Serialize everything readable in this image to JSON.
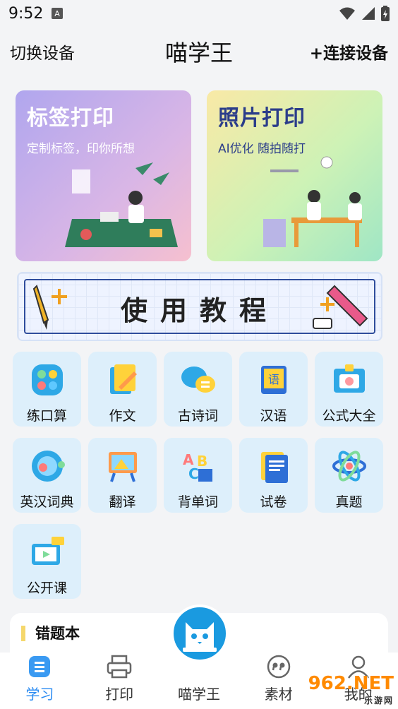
{
  "status": {
    "time": "9:52"
  },
  "header": {
    "left": "切换设备",
    "title": "喵学王",
    "right": "+连接设备"
  },
  "cards": [
    {
      "title": "标签打印",
      "subtitle": "定制标签，印你所想"
    },
    {
      "title": "照片打印",
      "subtitle": "AI优化 随拍随打"
    }
  ],
  "tutorial": {
    "title": "使用教程"
  },
  "grid": [
    {
      "label": "练口算",
      "icon": "calculator-icon"
    },
    {
      "label": "作文",
      "icon": "pen-paper-icon"
    },
    {
      "label": "古诗词",
      "icon": "chat-bubbles-icon"
    },
    {
      "label": "汉语",
      "icon": "chinese-book-icon"
    },
    {
      "label": "公式大全",
      "icon": "id-card-icon"
    },
    {
      "label": "英汉词典",
      "icon": "globe-icon"
    },
    {
      "label": "翻译",
      "icon": "easel-icon"
    },
    {
      "label": "背单词",
      "icon": "abc-icon"
    },
    {
      "label": "试卷",
      "icon": "exam-paper-icon"
    },
    {
      "label": "真题",
      "icon": "atom-icon"
    },
    {
      "label": "公开课",
      "icon": "video-screen-icon"
    }
  ],
  "wrong_book": {
    "title": "错题本"
  },
  "tabs": [
    {
      "label": "学习",
      "icon": "study-icon",
      "active": true
    },
    {
      "label": "打印",
      "icon": "printer-icon"
    },
    {
      "label": "喵学王",
      "icon": "cat-logo-icon"
    },
    {
      "label": "素材",
      "icon": "quote-icon"
    },
    {
      "label": "我的",
      "icon": "user-icon"
    }
  ],
  "watermark": {
    "text": "962.NET",
    "sub": "乐游网"
  }
}
